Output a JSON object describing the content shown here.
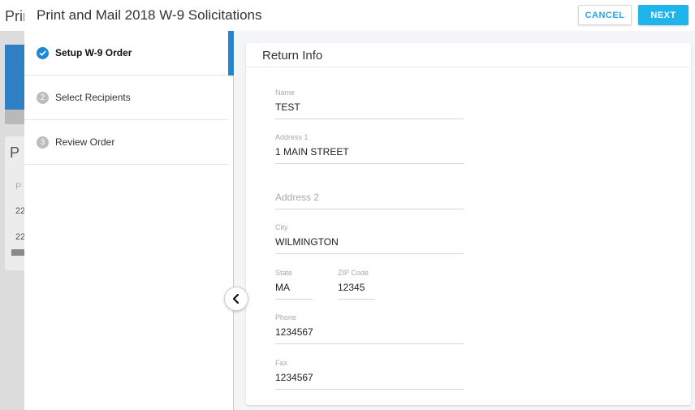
{
  "background": {
    "header_title": "Print",
    "card_title": "P",
    "row_1": "P",
    "row_2": "22",
    "row_3": "22"
  },
  "modal": {
    "title": "Print and Mail 2018 W-9 Solicitations",
    "cancel_label": "CANCEL",
    "next_label": "NEXT"
  },
  "steps": [
    {
      "number": "✓",
      "label": "Setup W-9 Order",
      "status": "active"
    },
    {
      "number": "2",
      "label": "Select Recipients",
      "status": "pending"
    },
    {
      "number": "3",
      "label": "Review Order",
      "status": "pending"
    }
  ],
  "form": {
    "title": "Return Info",
    "name": {
      "label": "Name",
      "value": "TEST"
    },
    "address1": {
      "label": "Address 1",
      "value": "1 MAIN STREET"
    },
    "address2": {
      "placeholder": "Address 2",
      "value": ""
    },
    "city": {
      "label": "City",
      "value": "WILMINGTON"
    },
    "state": {
      "label": "State",
      "value": "MA"
    },
    "zip": {
      "label": "ZIP Code",
      "value": "12345"
    },
    "phone": {
      "label": "Phone",
      "value": "1234567"
    },
    "fax": {
      "label": "Fax",
      "value": "1234567"
    }
  },
  "colors": {
    "accent": "#1e88d6",
    "next_button": "#1fb4ea",
    "cancel_text": "#29a4e6"
  },
  "icons": {
    "step_done": "check-icon",
    "collapse": "chevron-left-icon"
  }
}
